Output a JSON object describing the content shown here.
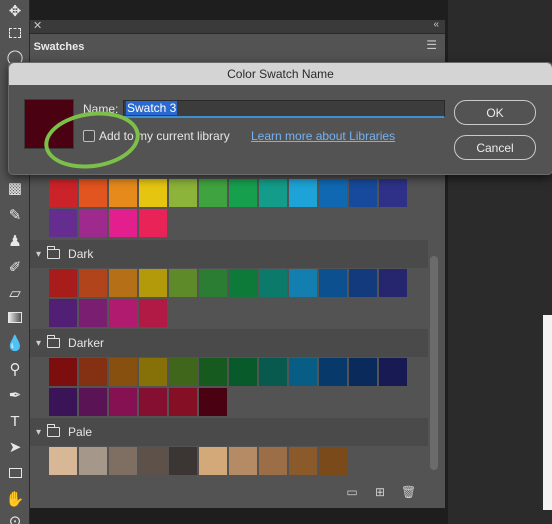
{
  "panel": {
    "tab_label": "Swatches"
  },
  "dialog": {
    "title": "Color Swatch Name",
    "name_label": "Name:",
    "name_value": "Swatch 3",
    "checkbox_label": "Add to my current library",
    "checkbox_checked": false,
    "learn_more": "Learn more about Libraries",
    "ok_label": "OK",
    "cancel_label": "Cancel",
    "preview_color": "#4a0212"
  },
  "annotation": {
    "color": "#7cc04a"
  },
  "groups": [
    {
      "name": "",
      "rows": [
        [
          "#cc2229",
          "#e25420",
          "#e68a1c",
          "#e6c511",
          "#8cb33a",
          "#3fa43f",
          "#16a04d",
          "#139c8a",
          "#1ea3d8",
          "#1068b3",
          "#174a9c",
          "#2e3187"
        ],
        [
          "#662d91",
          "#9e2a8e",
          "#e31f8d",
          "#e82357"
        ]
      ]
    },
    {
      "name": "Dark",
      "rows": [
        [
          "#a81c1c",
          "#b1441b",
          "#b56f16",
          "#b39a0a",
          "#5f8a2a",
          "#2a7d32",
          "#0d7a3a",
          "#0b7a6a",
          "#137fb0",
          "#0c5090",
          "#123a7c",
          "#25266e"
        ],
        [
          "#511f73",
          "#7a1e71",
          "#b01a6f",
          "#b01a45"
        ]
      ]
    },
    {
      "name": "Darker",
      "rows": [
        [
          "#7c0e0e",
          "#843012",
          "#87500e",
          "#857107",
          "#40661b",
          "#175a20",
          "#085a2a",
          "#085a4f",
          "#085d85",
          "#073a6b",
          "#0b2a5c",
          "#181a53"
        ],
        [
          "#3b1457",
          "#5a1354",
          "#861152",
          "#850f31",
          "#850f24",
          "#4a0212"
        ]
      ]
    },
    {
      "name": "Pale",
      "rows": [
        [
          "#d8b796",
          "#a6978b",
          "#7f6f63",
          "#5d514a",
          "#3b3634",
          "#d4a97a",
          "#b58b66",
          "#9c6e48",
          "#8a5a2a",
          "#7a4a1a"
        ]
      ]
    }
  ]
}
